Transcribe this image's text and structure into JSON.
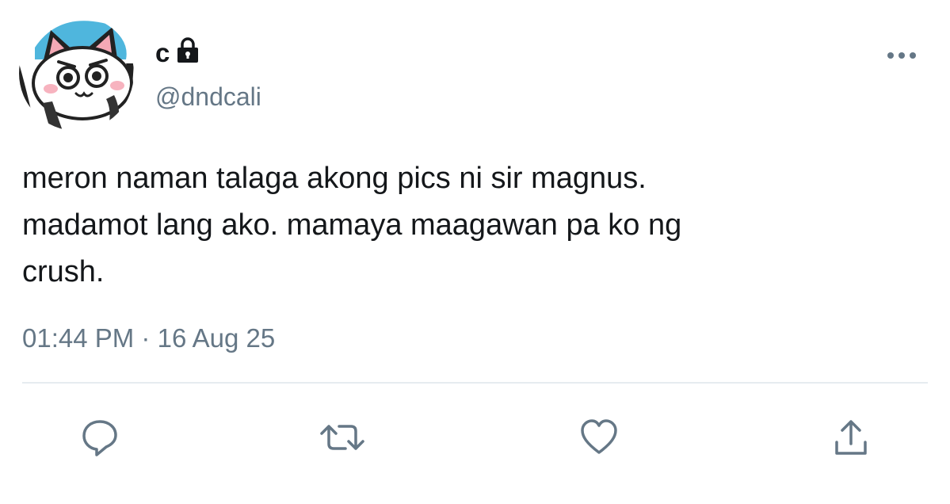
{
  "user": {
    "display_name": "c",
    "handle": "@dndcali",
    "protected": true,
    "avatar_icon": "cartoon-cat-avatar"
  },
  "menu": {
    "icon": "more-horizontal-icon"
  },
  "tweet": {
    "text": "meron naman talaga akong pics ni sir magnus.\nmadamot lang ako. mamaya maagawan pa ko ng\ncrush.",
    "time": "01:44 PM",
    "separator": "·",
    "date": "16 Aug 25"
  },
  "actions": [
    {
      "icon": "reply-icon"
    },
    {
      "icon": "retweet-icon"
    },
    {
      "icon": "like-icon"
    },
    {
      "icon": "share-icon"
    }
  ],
  "colors": {
    "text_primary": "#14171a",
    "text_secondary": "#657786",
    "divider": "#e6ecf0",
    "accent": "#1da1f2"
  }
}
